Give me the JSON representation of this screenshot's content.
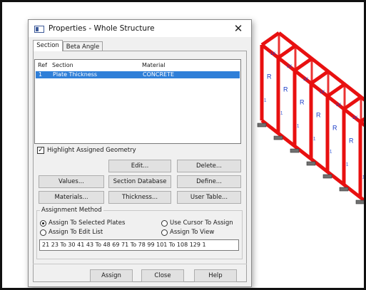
{
  "dialog": {
    "title": "Properties - Whole Structure",
    "close_glyph": "✕",
    "tabs": [
      {
        "label": "Section",
        "active": true
      },
      {
        "label": "Beta Angle",
        "active": false
      }
    ],
    "table": {
      "headers": [
        "Ref",
        "Section",
        "Material"
      ],
      "rows": [
        {
          "ref": "1",
          "section": "Plate Thickness",
          "material": "CONCRETE",
          "selected": true
        }
      ]
    },
    "highlight_checkbox": {
      "label": "Highlight Assigned Geometry",
      "checked": true,
      "mark": "✓"
    },
    "buttons": {
      "edit": "Edit...",
      "delete": "Delete...",
      "values": "Values...",
      "section_database": "Section Database",
      "define": "Define...",
      "materials": "Materials...",
      "thickness": "Thickness...",
      "user_table": "User Table..."
    },
    "assignment": {
      "legend": "Assignment Method",
      "options": [
        {
          "label": "Assign To Selected Plates",
          "selected": true
        },
        {
          "label": "Use Cursor To Assign",
          "selected": false
        },
        {
          "label": "Assign To Edit List",
          "selected": false
        },
        {
          "label": "Assign To View",
          "selected": false
        }
      ],
      "edit_list_value": "21 23 To 30 41 43 To 48 69 71 To 78 99 101 To 108 129 1"
    },
    "footer": {
      "assign": "Assign",
      "close": "Close",
      "help": "Help"
    }
  },
  "viewport": {
    "structure_color": "#e81010",
    "support_color": "#707070",
    "label_color": "#1a3cc8",
    "labels": [
      "R",
      "1K",
      "1"
    ]
  }
}
